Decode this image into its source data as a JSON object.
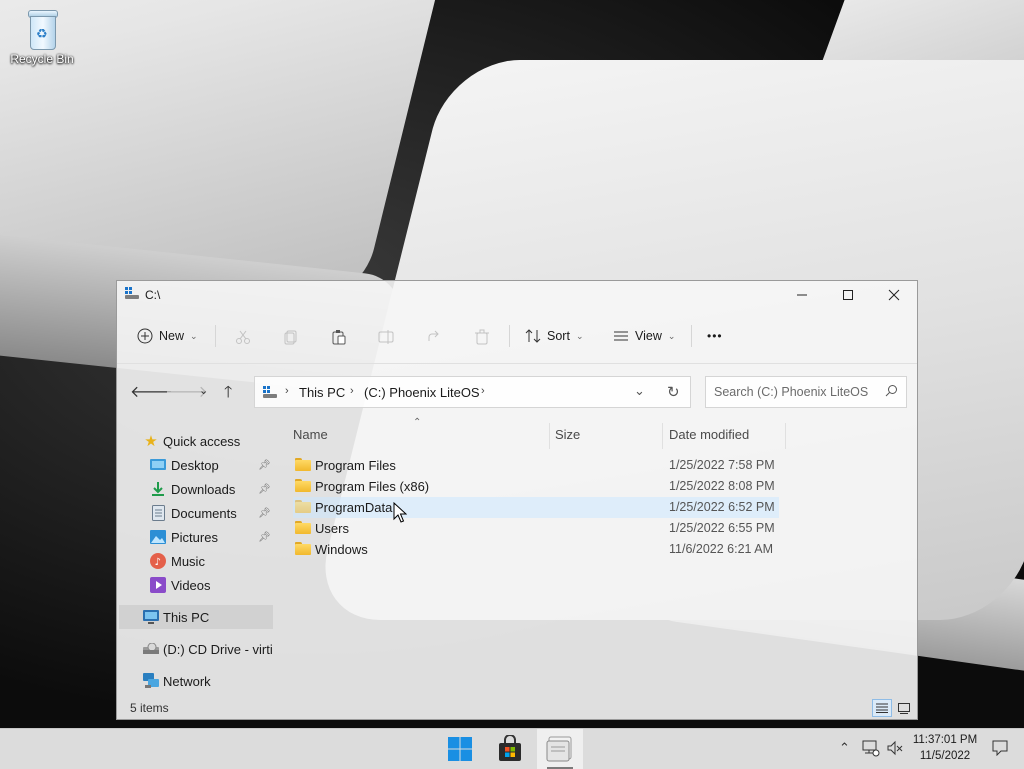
{
  "desktop": {
    "icons": [
      {
        "label": "Recycle Bin",
        "icon": "recycle-bin-icon"
      }
    ]
  },
  "window": {
    "title": "C:\\",
    "controls": {
      "minimize": "—",
      "maximize": "☐",
      "close": "✕"
    },
    "toolbar": {
      "new_label": "New",
      "sort_label": "Sort",
      "view_label": "View",
      "more_label": "•••",
      "disabled_actions": [
        "cut-icon",
        "copy-icon",
        "paste-icon",
        "rename-icon",
        "share-icon",
        "delete-icon"
      ]
    },
    "address": {
      "breadcrumbs": [
        "This PC",
        "(C:) Phoenix LiteOS"
      ],
      "search_placeholder": "Search (C:) Phoenix LiteOS"
    },
    "nav_pane": {
      "items": [
        {
          "label": "Quick access",
          "icon": "star-icon",
          "pinned": false
        },
        {
          "label": "Desktop",
          "icon": "desktop-icon",
          "pinned": true
        },
        {
          "label": "Downloads",
          "icon": "downloads-icon",
          "pinned": true
        },
        {
          "label": "Documents",
          "icon": "documents-icon",
          "pinned": true
        },
        {
          "label": "Pictures",
          "icon": "pictures-icon",
          "pinned": true
        },
        {
          "label": "Music",
          "icon": "music-icon",
          "pinned": false
        },
        {
          "label": "Videos",
          "icon": "videos-icon",
          "pinned": false
        },
        {
          "label": "This PC",
          "icon": "this-pc-icon",
          "selected": true
        },
        {
          "label": "(D:) CD Drive - virti",
          "icon": "cd-drive-icon"
        },
        {
          "label": "Network",
          "icon": "network-icon"
        }
      ]
    },
    "columns": [
      "Name",
      "Size",
      "Date modified"
    ],
    "files": [
      {
        "name": "Program Files",
        "size": "",
        "date": "1/25/2022 7:58 PM"
      },
      {
        "name": "Program Files (x86)",
        "size": "",
        "date": "1/25/2022 8:08 PM"
      },
      {
        "name": "ProgramData",
        "size": "",
        "date": "1/25/2022 6:52 PM",
        "hovered": true
      },
      {
        "name": "Users",
        "size": "",
        "date": "1/25/2022 6:55 PM"
      },
      {
        "name": "Windows",
        "size": "",
        "date": "11/6/2022 6:21 AM"
      }
    ],
    "status": {
      "item_count": "5 items"
    }
  },
  "taskbar": {
    "apps": [
      "start-icon",
      "store-icon",
      "file-explorer-icon"
    ],
    "active_app": "file-explorer-icon",
    "clock": {
      "time": "11:37:01 PM",
      "date": "11/5/2022"
    }
  },
  "colors": {
    "folder": "#f1b82d",
    "hover_row": "#cce8ff",
    "selected_nav": "#cdcdcd",
    "start_blue": "#1a8fe3"
  }
}
